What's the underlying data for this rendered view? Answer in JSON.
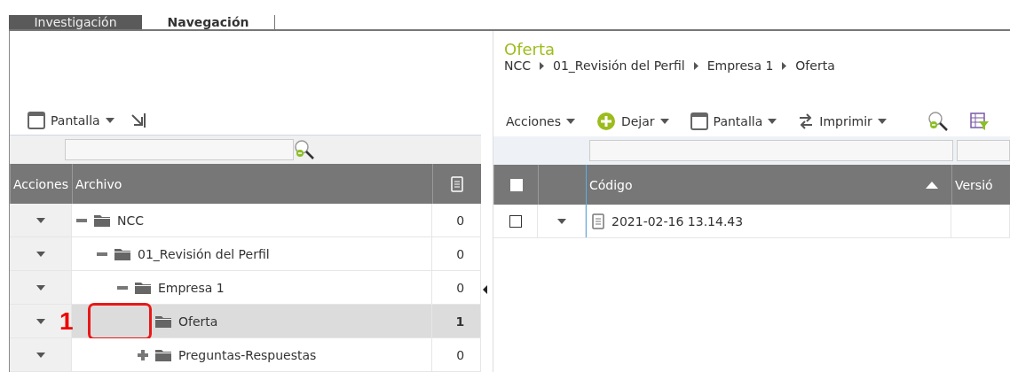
{
  "tabs": [
    {
      "label": "Investigación",
      "selected": false
    },
    {
      "label": "Navegación",
      "selected": true
    }
  ],
  "left_panel": {
    "toolbar": [
      {
        "kind": "display",
        "label": "Pantalla"
      },
      {
        "kind": "jump"
      }
    ],
    "columns": [
      "Acciones",
      "Archivo"
    ],
    "tree": [
      {
        "label": "NCC",
        "count": "0",
        "kind": "branch",
        "expanded": true,
        "selected": false,
        "children": [
          {
            "label": "01_Revisión del Perfil",
            "count": "0",
            "kind": "branch",
            "expanded": true,
            "selected": false,
            "children": [
              {
                "label": "Empresa 1",
                "count": "0",
                "kind": "branch",
                "expanded": true,
                "selected": false,
                "children": [
                  {
                    "label": "Oferta",
                    "count": "1",
                    "kind": "leaf",
                    "selected": true
                  },
                  {
                    "label": "Preguntas-Respuestas",
                    "count": "0",
                    "kind": "branch",
                    "expanded": false,
                    "selected": false
                  }
                ]
              }
            ]
          }
        ]
      }
    ]
  },
  "annotation": {
    "label": "1"
  },
  "right_panel": {
    "title": "Oferta",
    "breadcrumb": [
      "NCC",
      "01_Revisión del Perfil",
      "Empresa 1",
      "Oferta"
    ],
    "toolbar": [
      {
        "kind": "menu",
        "label": "Acciones"
      },
      {
        "kind": "add",
        "label": "Dejar"
      },
      {
        "kind": "display",
        "label": "Pantalla"
      },
      {
        "kind": "print",
        "label": "Imprimir"
      },
      {
        "kind": "search"
      },
      {
        "kind": "filter"
      }
    ],
    "all_checked": false,
    "columns": [
      {
        "label": "Código",
        "sorted": true
      },
      {
        "label": "Versió",
        "sorted": false
      }
    ],
    "rows": [
      {
        "checked": false,
        "code": "2021-02-16 13.14.43"
      }
    ]
  }
}
